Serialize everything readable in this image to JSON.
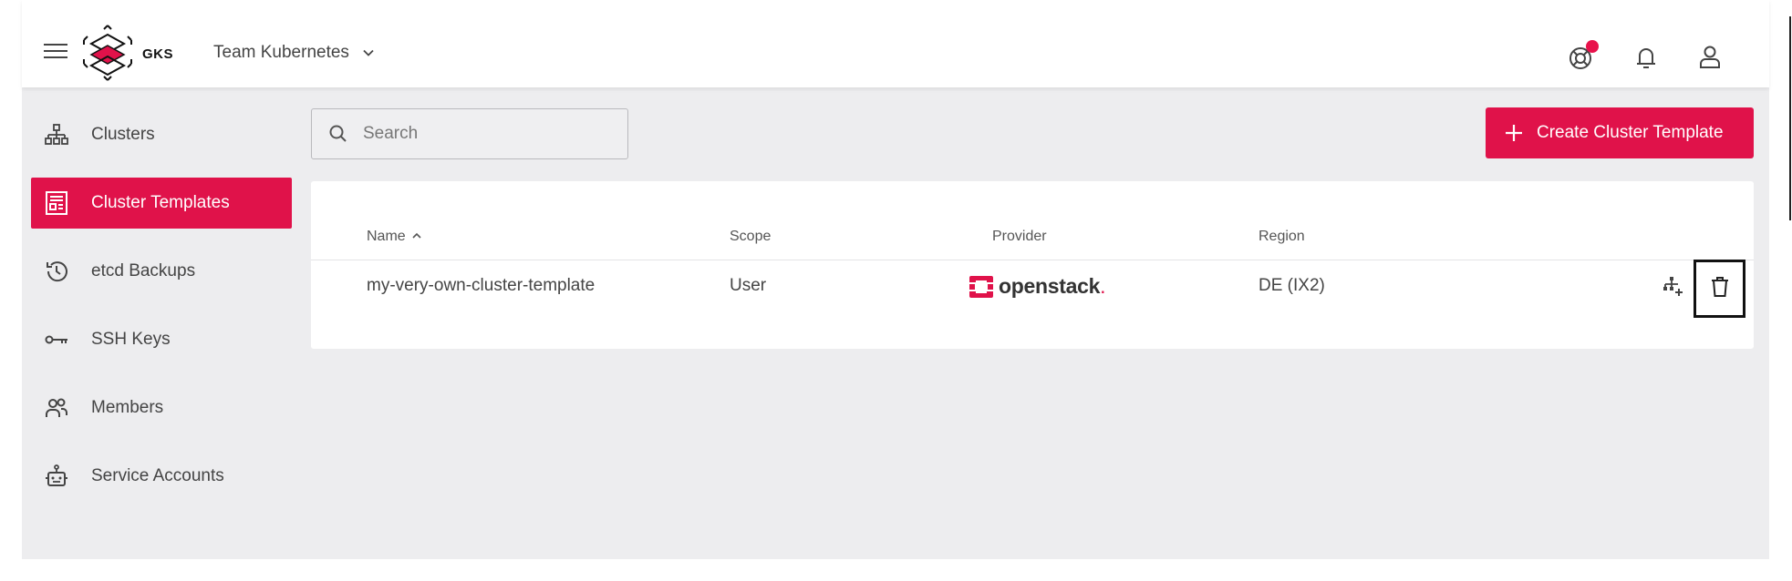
{
  "header": {
    "logo_text": "GKS",
    "team_name": "Team Kubernetes",
    "icons": [
      "menu-icon",
      "support-icon",
      "bell-icon",
      "user-icon"
    ],
    "notification_dot": true
  },
  "sidebar": {
    "items": [
      {
        "label": "Clusters",
        "icon": "clusters-icon",
        "active": false
      },
      {
        "label": "Cluster Templates",
        "icon": "template-icon",
        "active": true
      },
      {
        "label": "etcd Backups",
        "icon": "history-icon",
        "active": false
      },
      {
        "label": "SSH Keys",
        "icon": "key-icon",
        "active": false
      },
      {
        "label": "Members",
        "icon": "members-icon",
        "active": false
      },
      {
        "label": "Service Accounts",
        "icon": "robot-icon",
        "active": false
      }
    ]
  },
  "toolbar": {
    "search_placeholder": "Search",
    "create_label": "Create Cluster Template"
  },
  "table": {
    "headers": {
      "name": "Name",
      "scope": "Scope",
      "provider": "Provider",
      "region": "Region"
    },
    "rows": [
      {
        "name": "my-very-own-cluster-template",
        "scope": "User",
        "provider": "openstack",
        "provider_suffix": ".",
        "region": "DE (IX2)"
      }
    ]
  },
  "colors": {
    "accent": "#e0124a",
    "background": "#ededef",
    "surface": "#ffffff"
  }
}
